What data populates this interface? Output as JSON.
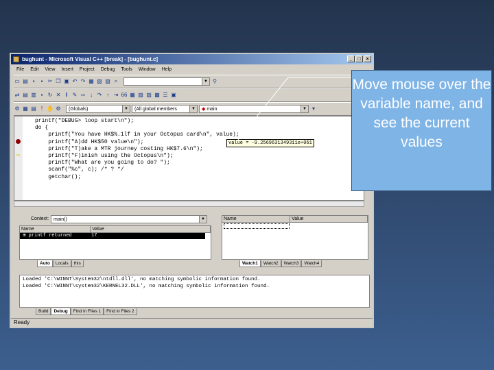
{
  "window": {
    "title": "bughunt - Microsoft Visual C++ [break] - [bughunt.c]",
    "controls": [
      "_",
      "□",
      "×"
    ]
  },
  "menu": [
    "File",
    "Edit",
    "View",
    "Insert",
    "Project",
    "Debug",
    "Tools",
    "Window",
    "Help"
  ],
  "toolbar3": {
    "scope_combo": "(Globals)",
    "members_combo": "(All global members",
    "function_combo": "main"
  },
  "code_lines": [
    "printf(\"DEBUG> loop start\\n\");",
    "",
    "do {",
    "    printf(\"You have HK$%.1lf in your Octopus card\\n\", value);",
    "    printf(\"A)dd HK$50 value\\n\");",
    "    printf(\"T)ake a MTR journey costing HK$7.6\\n\");",
    "    printf(\"F)inish using the Octopus\\n\");",
    "    printf(\"What are you going to do? \");",
    "",
    "    scanf(\"%c\", c); /* ? */",
    "    getchar();"
  ],
  "datatip": "value = -9.2569631349311e+061",
  "variables": {
    "context_label": "Context:",
    "context_value": "main()",
    "col_name": "Name",
    "col_value": "Value",
    "row_name": "printf returned",
    "row_value": "17",
    "tabs": [
      "Auto",
      "Locals",
      "this"
    ]
  },
  "watch": {
    "col_name": "Name",
    "col_value": "Value",
    "tabs": [
      "Watch1",
      "Watch2",
      "Watch3",
      "Watch4"
    ]
  },
  "output_lines": [
    "Loaded 'C:\\WINNT\\System32\\ntdll.dll', no matching symbolic information found.",
    "Loaded 'C:\\WINNT\\system32\\KERNEL32.DLL', no matching symbolic information found."
  ],
  "output_tabs": [
    "Build",
    "Debug",
    "Find in Files 1",
    "Find in Files 2"
  ],
  "status": "Ready",
  "callout": "Move mouse over the variable name, and see the current values",
  "colors": {
    "background": "#2e466a",
    "callout": "#7fb4e6",
    "titlebar": "#0a246a",
    "breakpoint": "#8b0000"
  }
}
